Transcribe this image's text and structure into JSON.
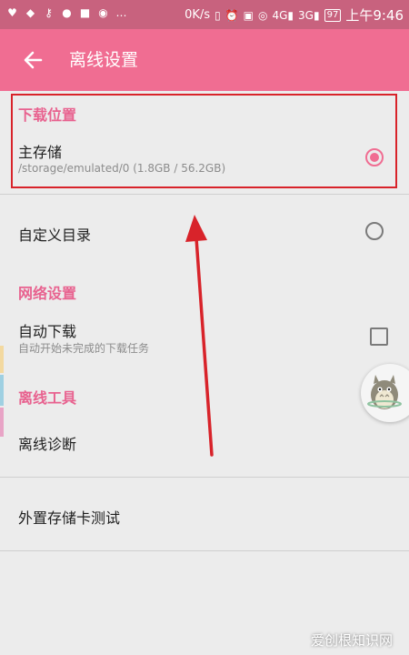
{
  "status_bar": {
    "left_icons": [
      "heartbeat-icon",
      "shield-icon",
      "key-icon",
      "wechat-icon",
      "app-icon",
      "camera-icon",
      "more-dots-icon"
    ],
    "network_speed": "0K/s",
    "signal_4g_1": "4G",
    "signal_3g": "3G",
    "battery": "97",
    "time": "上午9:46"
  },
  "app_bar": {
    "back_icon": "arrow-left-icon",
    "title": "离线设置"
  },
  "sections": {
    "download_location": {
      "header": "下载位置",
      "main_storage": {
        "label": "主存储",
        "path": "/storage/emulated/0 (1.8GB / 56.2GB)",
        "selected": true
      },
      "custom_dir": {
        "label": "自定义目录",
        "selected": false
      }
    },
    "network": {
      "header": "网络设置",
      "auto_download": {
        "label": "自动下载",
        "description": "自动开始未完成的下载任务",
        "checked": false
      }
    },
    "offline_tools": {
      "header": "离线工具",
      "diagnose": {
        "label": "离线诊断"
      },
      "sdcard_test": {
        "label": "外置存储卡测试"
      }
    }
  },
  "floating_button": {
    "icon": "totoro-mascot-icon"
  },
  "watermark": "爱创根知识网",
  "colors": {
    "accent": "#f06d92",
    "annotation_red": "#d8232a",
    "status_bar": "#c8627e"
  }
}
